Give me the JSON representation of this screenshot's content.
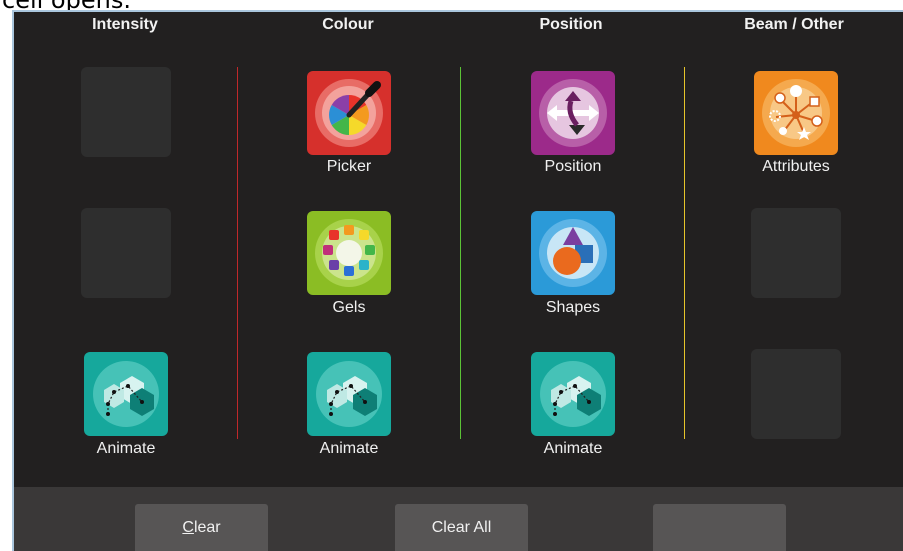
{
  "doc_text": "cell opens.",
  "columns": {
    "intensity": "Intensity",
    "colour": "Colour",
    "position": "Position",
    "beam": "Beam / Other"
  },
  "divider_colors": [
    "#c0282a",
    "#5bc236",
    "#e6c42a"
  ],
  "tiles": {
    "picker": "Picker",
    "gels": "Gels",
    "position": "Position",
    "shapes": "Shapes",
    "attributes": "Attributes",
    "animate": "Animate"
  },
  "icons": {
    "picker": "colour-picker-icon",
    "gels": "gels-palette-icon",
    "position": "position-arrows-icon",
    "shapes": "shapes-icon",
    "attributes": "attributes-icon",
    "animate": "animate-icon"
  },
  "footer": {
    "clear_first": "C",
    "clear_rest": "lear",
    "clear_all": "Clear All",
    "third": ""
  }
}
